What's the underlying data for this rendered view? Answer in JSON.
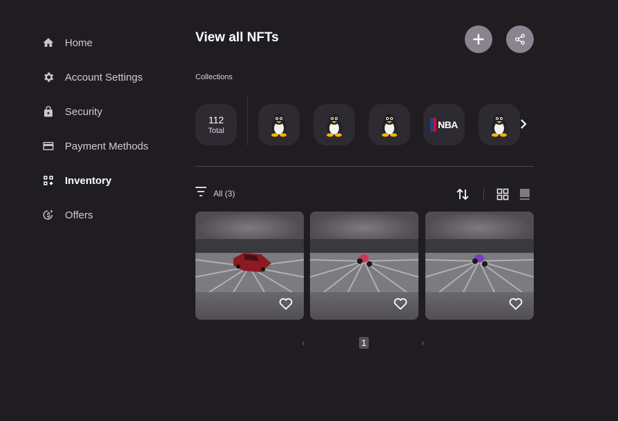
{
  "sidebar": {
    "items": [
      {
        "label": "Home",
        "icon": "home-icon"
      },
      {
        "label": "Account Settings",
        "icon": "gear-icon"
      },
      {
        "label": "Security",
        "icon": "lock-icon"
      },
      {
        "label": "Payment Methods",
        "icon": "wallet-icon"
      },
      {
        "label": "Inventory",
        "icon": "inventory-icon",
        "active": true
      },
      {
        "label": "Offers",
        "icon": "offers-icon"
      }
    ]
  },
  "main": {
    "title": "View all NFTs",
    "add_icon": "plus-icon",
    "share_icon": "share-icon",
    "collections_label": "Collections",
    "collections": {
      "total_count": "112",
      "total_label": "Total",
      "items": [
        {
          "icon": "penguin-icon"
        },
        {
          "icon": "penguin-icon"
        },
        {
          "icon": "penguin-icon"
        },
        {
          "icon": "nba-logo",
          "logo_text": "NBA"
        },
        {
          "icon": "penguin-icon"
        }
      ]
    },
    "filter": {
      "label": "All (3)"
    },
    "nfts": [
      {
        "subject": "red car",
        "color": "#8b1a22"
      },
      {
        "subject": "motorcycle",
        "color": "#c83a5a"
      },
      {
        "subject": "motorcycle",
        "color": "#7a3fbf"
      }
    ],
    "pagination": {
      "prev": "‹",
      "current": "1",
      "next": "›"
    }
  },
  "colors": {
    "background": "#201d22",
    "card": "#2e2a31",
    "button": "#8b8490"
  }
}
